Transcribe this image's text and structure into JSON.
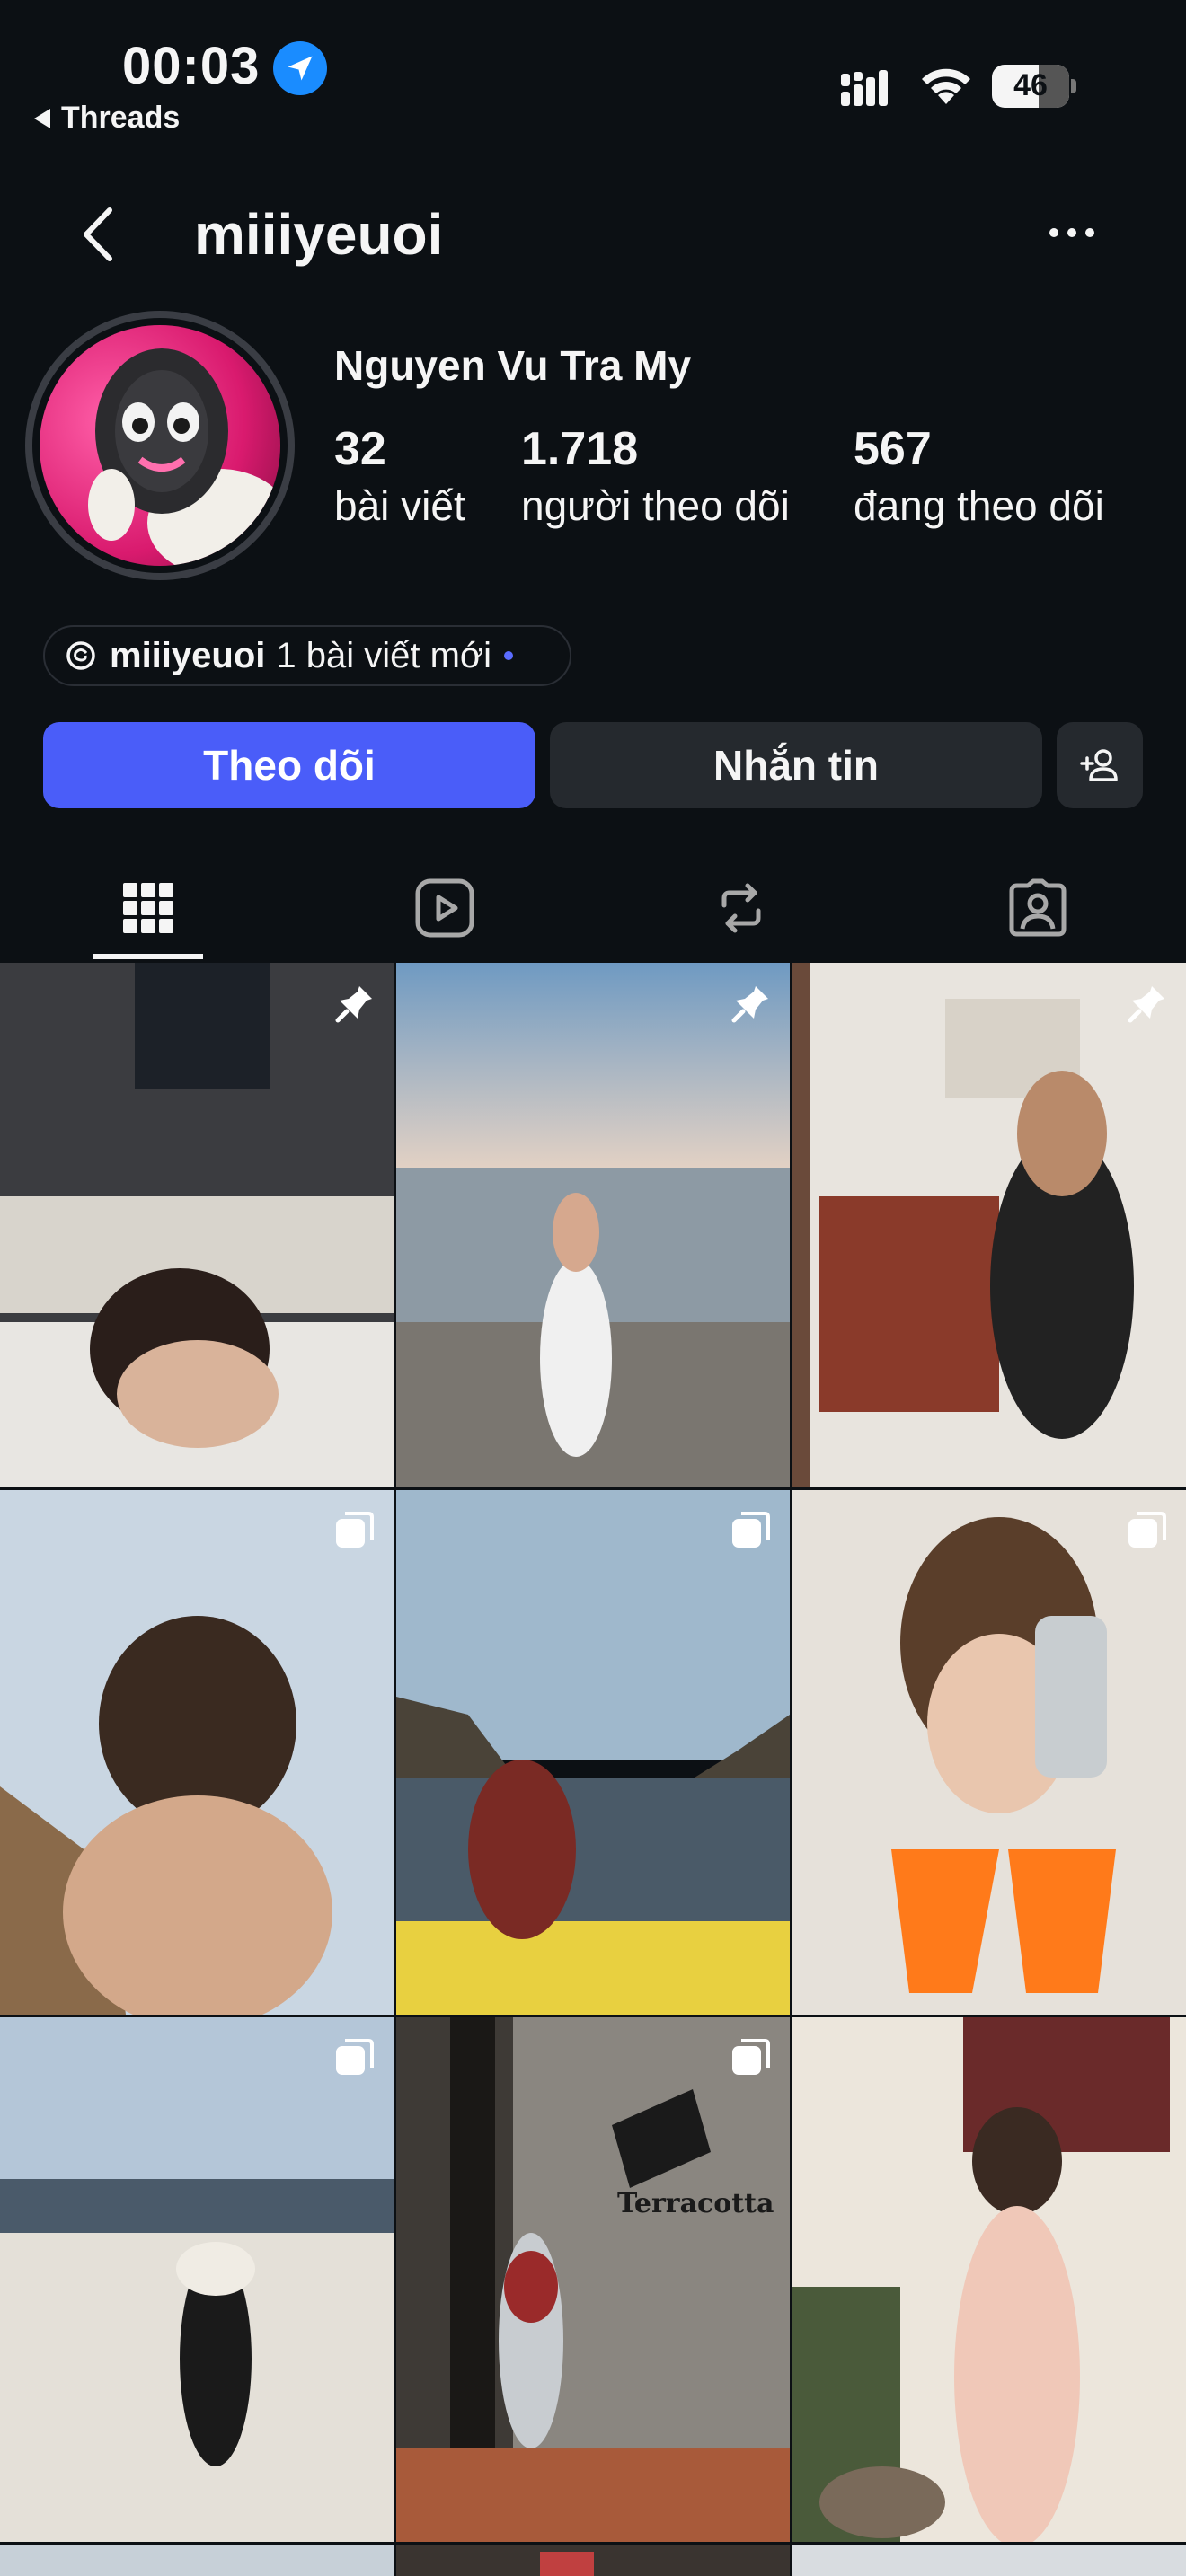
{
  "status_bar": {
    "time": "00:03",
    "back_app": "Threads",
    "battery": "46"
  },
  "header": {
    "username": "miiiyeuoi"
  },
  "profile": {
    "full_name": "Nguyen Vu Tra My",
    "stats": [
      {
        "value": "32",
        "label": "bài viết"
      },
      {
        "value": "1.718",
        "label": "người theo dõi"
      },
      {
        "value": "567",
        "label": "đang theo dõi"
      }
    ],
    "threads_badge": {
      "handle": "miiiyeuoi",
      "text": "1 bài viết mới"
    }
  },
  "actions": {
    "follow": "Theo dõi",
    "message": "Nhắn tin"
  },
  "tabs": [
    "grid",
    "reels",
    "reposts",
    "tagged"
  ],
  "colors": {
    "background": "#0c1014",
    "follow_button": "#4a5df9",
    "secondary_button": "#25292e",
    "location_icon": "#1a8cff"
  },
  "posts": [
    {
      "badge": "pin-icon"
    },
    {
      "badge": "pin-icon"
    },
    {
      "badge": "pin-icon"
    },
    {
      "badge": "carousel-icon"
    },
    {
      "badge": "carousel-icon"
    },
    {
      "badge": "carousel-icon"
    },
    {
      "badge": "carousel-icon"
    },
    {
      "badge": "carousel-icon",
      "overlay_text": "Terracotta"
    },
    {
      "badge": ""
    }
  ]
}
